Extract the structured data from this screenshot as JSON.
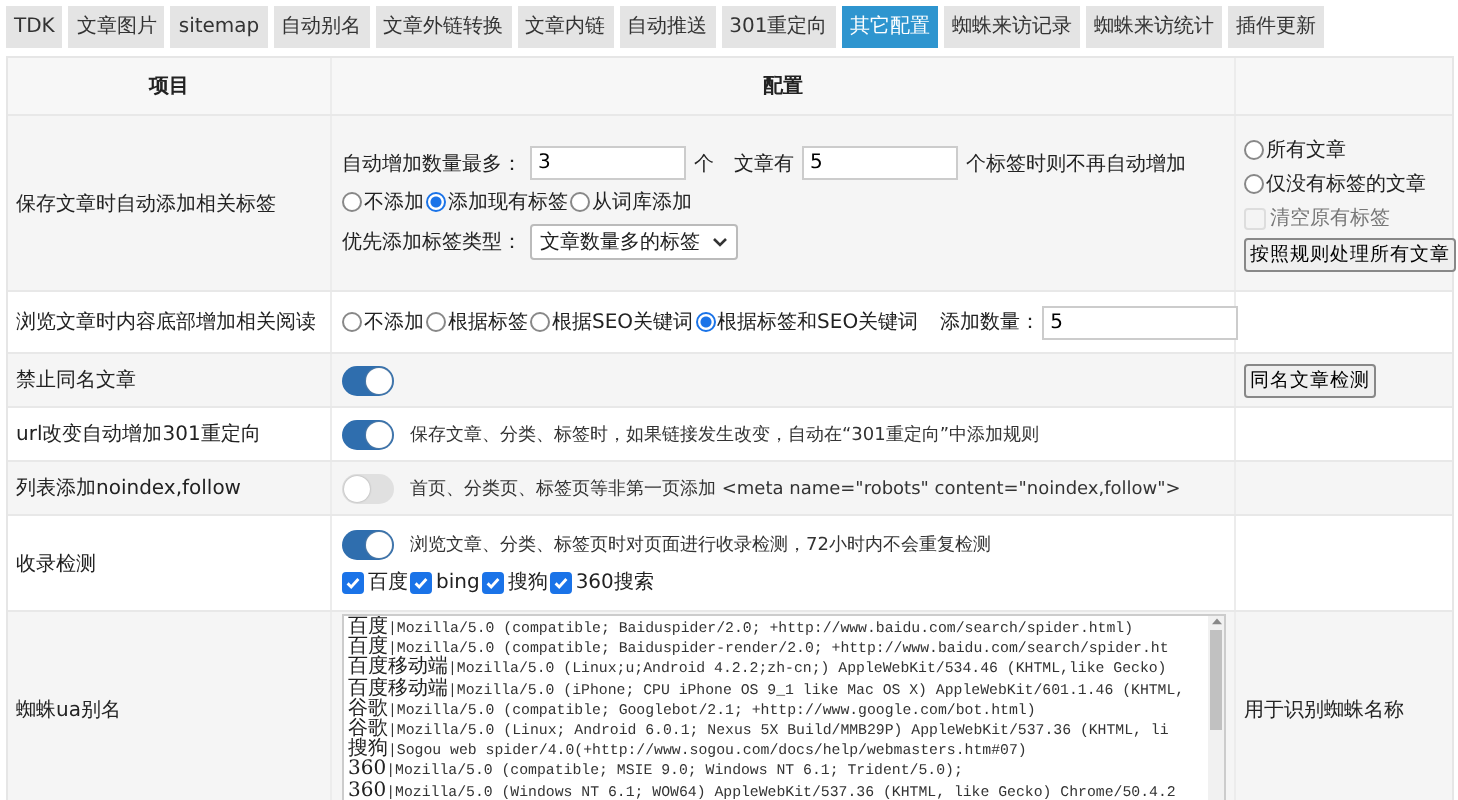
{
  "tabs": [
    {
      "label": "TDK",
      "selected": false
    },
    {
      "label": "文章图片",
      "selected": false
    },
    {
      "label": "sitemap",
      "selected": false
    },
    {
      "label": "自动别名",
      "selected": false
    },
    {
      "label": "文章外链转换",
      "selected": false
    },
    {
      "label": "文章内链",
      "selected": false
    },
    {
      "label": "自动推送",
      "selected": false
    },
    {
      "label": "301重定向",
      "selected": false
    },
    {
      "label": "其它配置",
      "selected": true
    },
    {
      "label": "蜘蛛来访记录",
      "selected": false
    },
    {
      "label": "蜘蛛来访统计",
      "selected": false
    },
    {
      "label": "插件更新",
      "selected": false
    }
  ],
  "table": {
    "columns": [
      "项目",
      "配置"
    ],
    "rows": [
      {
        "kind": "tag_rule",
        "label": "保存文章时自动添加相关标签",
        "max_label": "自动增加数量最多：",
        "max_value": "3",
        "max_unit": "个",
        "has_label": "文章有",
        "has_value": "5",
        "has_suffix": "个标签时则不再自动增加",
        "mode_options": [
          {
            "label": "不添加",
            "selected": false
          },
          {
            "label": "添加现有标签",
            "selected": true
          },
          {
            "label": "从词库添加",
            "selected": false
          }
        ],
        "priority_label": "优先添加标签类型：",
        "priority_value": "文章数量多的标签",
        "scope_options": [
          {
            "label": "所有文章",
            "selected": false
          },
          {
            "label": "仅没有标签的文章",
            "selected": false
          }
        ],
        "clear_option": {
          "label": "清空原有标签",
          "checked": false,
          "disabled": true
        },
        "action_button": "按照规则处理所有文章"
      },
      {
        "kind": "related",
        "label": "浏览文章时内容底部增加相关阅读",
        "options": [
          {
            "label": "不添加",
            "selected": false
          },
          {
            "label": "根据标签",
            "selected": false
          },
          {
            "label": "根据SEO关键词",
            "selected": false
          },
          {
            "label": "根据标签和SEO关键词",
            "selected": true
          }
        ],
        "count_label": "添加数量：",
        "count_value": "5"
      },
      {
        "kind": "toggle",
        "label": "禁止同名文章",
        "on": true,
        "action_button": "同名文章检测"
      },
      {
        "kind": "toggle",
        "label": "url改变自动增加301重定向",
        "on": true,
        "note": "保存文章、分类、标签时，如果链接发生改变，自动在“301重定向”中添加规则"
      },
      {
        "kind": "toggle",
        "label": "列表添加noindex,follow",
        "on": false,
        "note": "首页、分类页、标签页等非第一页添加 <meta name=\"robots\" content=\"noindex,follow\">"
      },
      {
        "kind": "toggle",
        "label": "收录检测",
        "on": true,
        "note": "浏览文章、分类、标签页时对页面进行收录检测，72小时内不会重复检测",
        "engines": [
          {
            "label": "百度",
            "checked": true
          },
          {
            "label": "bing",
            "checked": true
          },
          {
            "label": "搜狗",
            "checked": true
          },
          {
            "label": "360搜索",
            "checked": true
          }
        ]
      },
      {
        "kind": "textarea",
        "label": "蜘蛛ua别名",
        "side_note": "用于识别蜘蛛名称",
        "lines": [
          "百度|Mozilla/5.0 (compatible; Baiduspider/2.0; +http://www.baidu.com/search/spider.html)",
          "百度|Mozilla/5.0 (compatible; Baiduspider-render/2.0; +http://www.baidu.com/search/spider.ht",
          "百度移动端|Mozilla/5.0 (Linux;u;Android 4.2.2;zh-cn;) AppleWebKit/534.46 (KHTML,like Gecko)",
          "百度移动端|Mozilla/5.0 (iPhone; CPU iPhone OS 9_1 like Mac OS X) AppleWebKit/601.1.46 (KHTML,",
          "谷歌|Mozilla/5.0 (compatible; Googlebot/2.1; +http://www.google.com/bot.html)",
          "谷歌|Mozilla/5.0 (Linux; Android 6.0.1; Nexus 5X Build/MMB29P) AppleWebKit/537.36 (KHTML, li",
          "搜狗|Sogou web spider/4.0(+http://www.sogou.com/docs/help/webmasters.htm#07)",
          "360|Mozilla/5.0 (compatible; MSIE 9.0; Windows NT 6.1; Trident/5.0);",
          "360|Mozilla/5.0 (Windows NT 6.1; WOW64) AppleWebKit/537.36 (KHTML, like Gecko) Chrome/50.4.2"
        ]
      }
    ]
  }
}
